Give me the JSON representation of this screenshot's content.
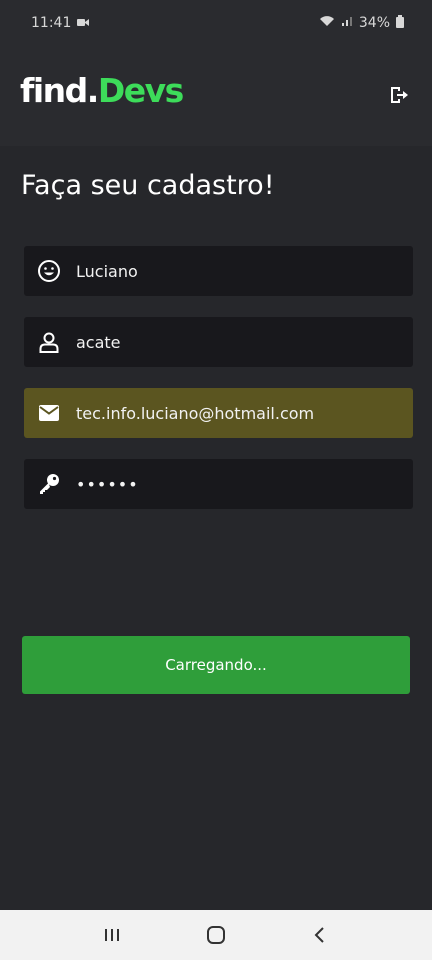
{
  "status_bar": {
    "time": "11:41",
    "battery": "34%"
  },
  "header": {
    "logo_part1": "find.",
    "logo_part2": "Devs",
    "logo_accent": "#3ddc5a"
  },
  "form": {
    "title": "Faça seu cadastro!",
    "fields": [
      {
        "icon": "smiley-icon",
        "value": "Luciano"
      },
      {
        "icon": "user-icon",
        "value": "acate"
      },
      {
        "icon": "mail-icon",
        "value": "tec.info.luciano@hotmail.com"
      },
      {
        "icon": "key-icon",
        "value": "••••••"
      }
    ],
    "submit_label": "Carregando..."
  },
  "colors": {
    "background": "#26272b",
    "field_bg": "#18181c",
    "autofill_bg": "#5b5520",
    "button": "#2f9e3a"
  }
}
